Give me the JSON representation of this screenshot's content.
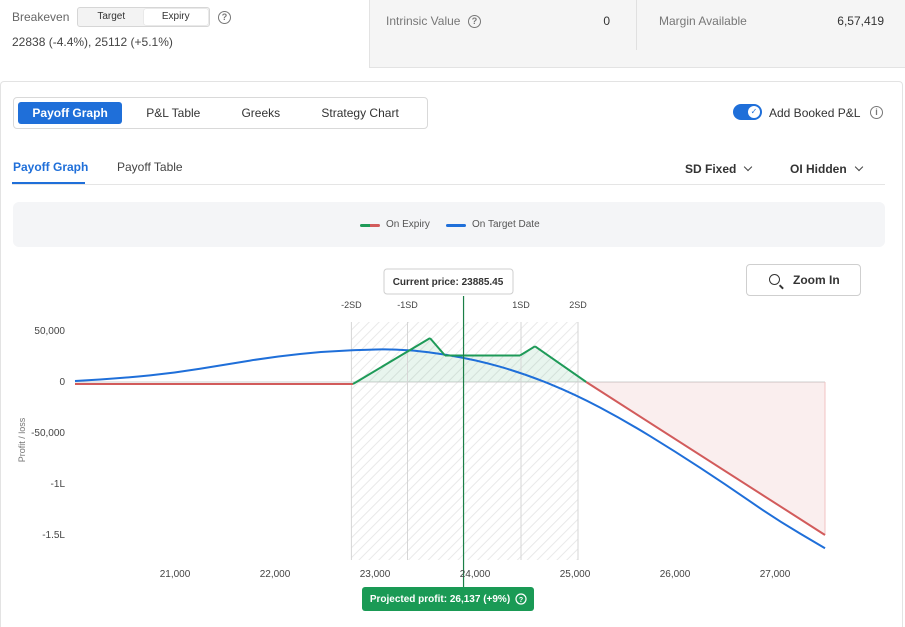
{
  "summary": {
    "breakeven_label": "Breakeven",
    "breakeven_modes": [
      "Target",
      "Expiry"
    ],
    "breakeven_selected": "Expiry",
    "breakeven_values": "22838 (-4.4%), 25112 (+5.1%)",
    "intrinsic_label": "Intrinsic Value",
    "intrinsic_value": "0",
    "margin_label": "Margin Available",
    "margin_value": "6,57,419"
  },
  "main_tabs": [
    "Payoff Graph",
    "P&L Table",
    "Greeks",
    "Strategy Chart"
  ],
  "main_tab_active": "Payoff Graph",
  "toggle": {
    "label": "Add Booked P&L",
    "on": true
  },
  "sub_tabs": [
    "Payoff Graph",
    "Payoff Table"
  ],
  "sub_tab_active": "Payoff Graph",
  "dropdowns": {
    "sd": "SD Fixed",
    "oi": "OI Hidden"
  },
  "legend": {
    "expiry": "On Expiry",
    "target": "On Target Date"
  },
  "zoom_label": "Zoom In",
  "colors": {
    "accent": "#1f6fd9",
    "profit": "#1e9a58",
    "loss": "#d25b5b",
    "target_line": "#1f6fd9"
  },
  "chart_data": {
    "type": "line",
    "ylabel": "Profit / loss",
    "x_ticks": [
      21000,
      22000,
      23000,
      24000,
      25000,
      26000,
      27000
    ],
    "x_tick_labels": [
      "21,000",
      "22,000",
      "23,000",
      "24,000",
      "25,000",
      "26,000",
      "27,000"
    ],
    "xlim": [
      20000,
      27500
    ],
    "y_ticks": [
      50000,
      0,
      -50000,
      -100000,
      -150000
    ],
    "y_tick_labels": [
      "50,000",
      "0",
      "-50,000",
      "-1L",
      "-1.5L"
    ],
    "ylim": [
      -165000,
      60000
    ],
    "current_price": 23885.45,
    "current_price_label": "Current price: 23885.45",
    "projected_profit_label": "Projected profit: 26,137 (+9%)",
    "sd_lines": [
      {
        "label": "-2SD",
        "x": 22764
      },
      {
        "label": "-1SD",
        "x": 23325
      },
      {
        "label": "1SD",
        "x": 24460
      },
      {
        "label": "2SD",
        "x": 25030
      }
    ],
    "series": [
      {
        "name": "On Expiry",
        "x": [
          20000,
          22780,
          23550,
          23700,
          24000,
          24450,
          24600,
          25112,
          27500
        ],
        "y": [
          -2000,
          -2000,
          43000,
          26000,
          26000,
          26000,
          35000,
          0,
          -150000
        ]
      },
      {
        "name": "On Target Date",
        "x": [
          20000,
          20500,
          21000,
          21500,
          22000,
          22500,
          23000,
          23200,
          23500,
          24000,
          24500,
          25000,
          25500,
          26000,
          26500,
          27000,
          27500
        ],
        "y": [
          1000,
          4000,
          9000,
          17000,
          25000,
          30000,
          32000,
          32000,
          30000,
          22000,
          8000,
          -12000,
          -38000,
          -68000,
          -100000,
          -134000,
          -163000
        ]
      }
    ]
  }
}
